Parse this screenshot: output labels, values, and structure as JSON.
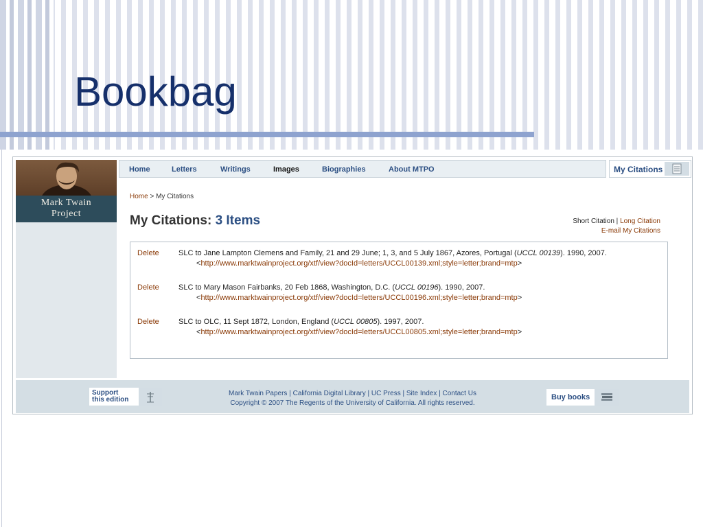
{
  "slide": {
    "title": "Bookbag"
  },
  "logo": {
    "line1": "Mark Twain",
    "line2": "Project"
  },
  "nav": {
    "items": [
      "Home",
      "Letters",
      "Writings",
      "Images",
      "Biographies",
      "About MTPO"
    ],
    "active": "Images"
  },
  "my_citations_button": "My Citations",
  "breadcrumb": {
    "home": "Home",
    "separator": " > ",
    "current": "My Citations"
  },
  "heading": {
    "label": "My Citations:",
    "count": "3 Items"
  },
  "citation_options": {
    "short": "Short Citation",
    "separator": " | ",
    "long": "Long Citation",
    "email": "E-mail My Citations"
  },
  "citations": [
    {
      "delete": "Delete",
      "text_pre": "SLC to Jane Lampton Clemens and Family, 21 and 29 June; 1, 3, and 5 July 1867, Azores, Portugal (",
      "id": "UCCL 00139",
      "text_post": "). 1990, 2007.",
      "url_open": "<",
      "url": "http://www.marktwainproject.org/xtf/view?docId=letters/UCCL00139.xml;style=letter;brand=mtp",
      "url_close": ">"
    },
    {
      "delete": "Delete",
      "text_pre": "SLC to Mary Mason Fairbanks, 20 Feb 1868, Washington, D.C. (",
      "id": "UCCL 00196",
      "text_post": "). 1990, 2007.",
      "url_open": "<",
      "url": "http://www.marktwainproject.org/xtf/view?docId=letters/UCCL00196.xml;style=letter;brand=mtp",
      "url_close": ">"
    },
    {
      "delete": "Delete",
      "text_pre": "SLC to OLC, 11 Sept 1872, London, England (",
      "id": "UCCL 00805",
      "text_post": "). 1997, 2007.",
      "url_open": "<",
      "url": "http://www.marktwainproject.org/xtf/view?docId=letters/UCCL00805.xml;style=letter;brand=mtp",
      "url_close": ">"
    }
  ],
  "footer": {
    "support_line1": "Support",
    "support_line2": "this edition",
    "links": [
      "Mark Twain Papers",
      "California Digital Library",
      "UC Press",
      "Site Index",
      "Contact Us"
    ],
    "link_separator": " | ",
    "copyright": "Copyright © 2007 The Regents of the University of California. All rights reserved.",
    "buy_books": "Buy books"
  },
  "colors": {
    "title": "#16306b",
    "nav_text": "#2c4f83",
    "link": "#8a3a07",
    "footer_bg": "#d4dee4",
    "sidebar_bg": "#e2e8ec"
  },
  "icons": {
    "my_citations": "notepad-icon",
    "support": "tree-icon",
    "buy_books": "book-stack-icon"
  }
}
